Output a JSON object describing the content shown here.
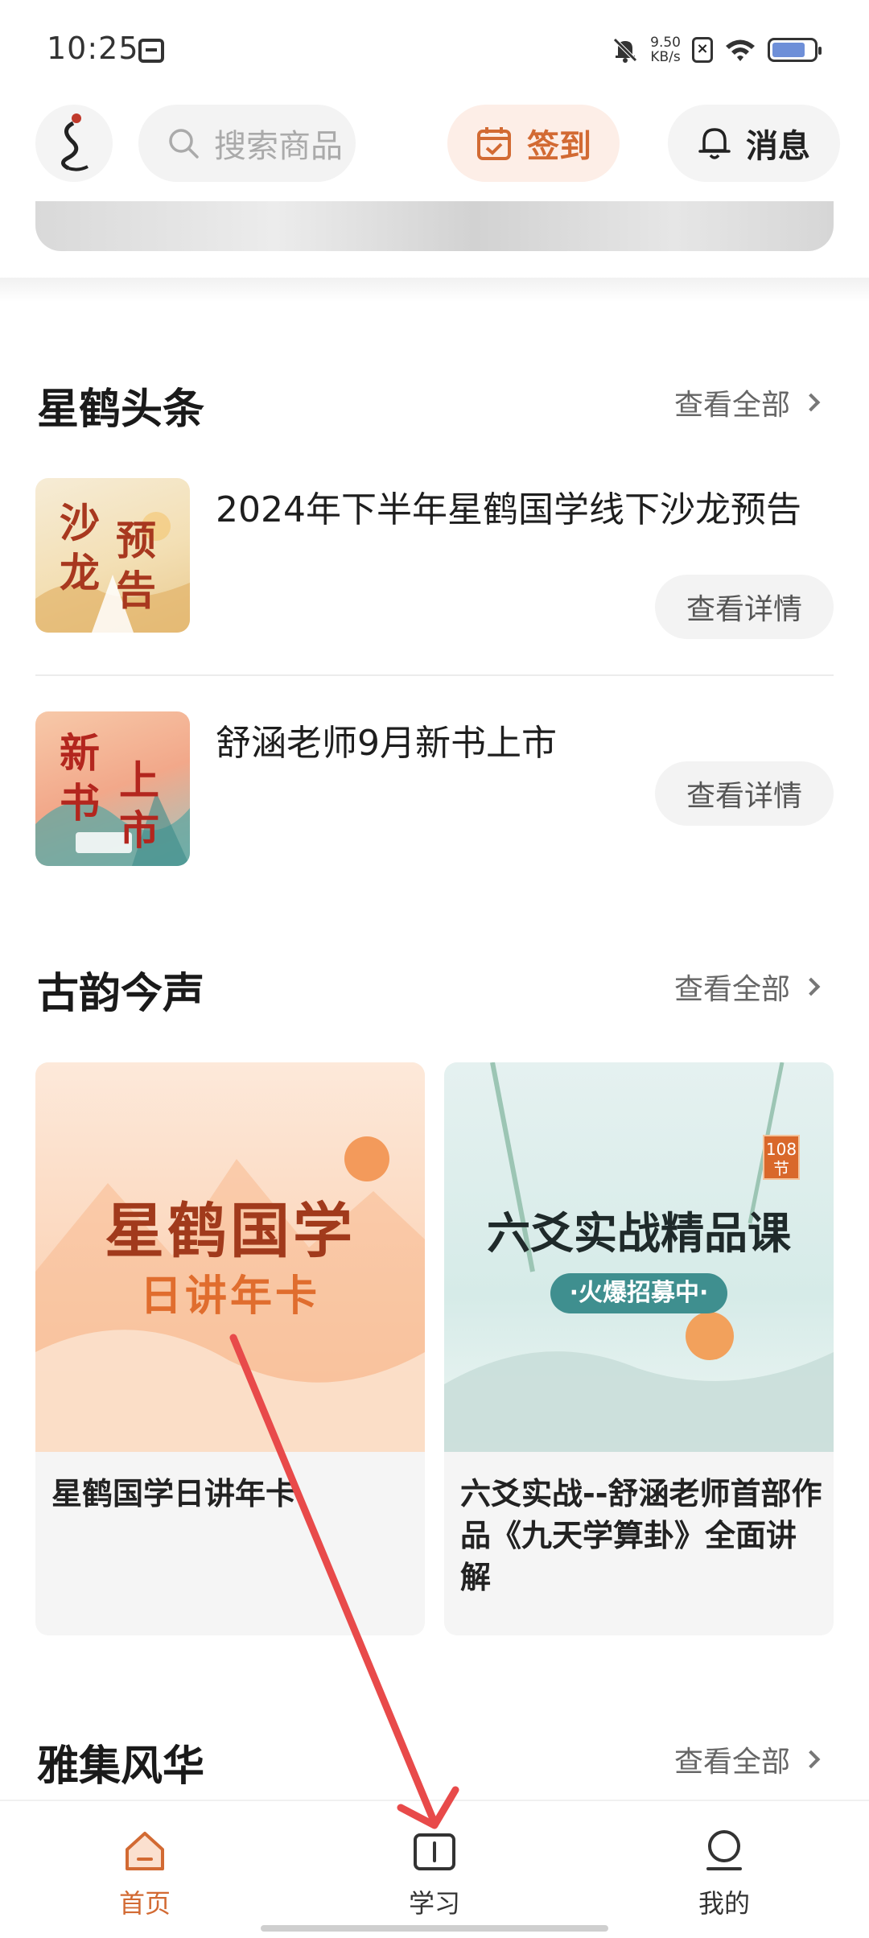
{
  "status_bar": {
    "time": "10:25",
    "net_speed_value": "9.50",
    "net_speed_unit": "KB/s",
    "battery_percent": 80
  },
  "header": {
    "search_placeholder": "搜索商品",
    "checkin_label": "签到",
    "message_label": "消息"
  },
  "colors": {
    "accent": "#d26a33",
    "checkin_bg": "#fdeee7",
    "arrow": "#e84a4a"
  },
  "headlines": {
    "title": "星鹤头条",
    "see_all": "查看全部",
    "items": [
      {
        "title": "2024年下半年星鹤国学线下沙龙预告",
        "button": "查看详情",
        "thumb_text": [
          "沙",
          "预",
          "龙",
          "告"
        ]
      },
      {
        "title": "舒涵老师9月新书上市",
        "button": "查看详情",
        "thumb_text": [
          "新",
          "上",
          "书",
          "市"
        ]
      }
    ]
  },
  "courses": {
    "title": "古韵今声",
    "see_all": "查看全部",
    "cards": [
      {
        "image_title": "星鹤国学",
        "image_subtitle": "日讲年卡",
        "title": "星鹤国学日讲年卡"
      },
      {
        "image_title": "六爻实战精品课",
        "image_subtitle": "·火爆招募中·",
        "image_badge_top": "108",
        "image_badge_bottom": "节",
        "title": "六爻实战--舒涵老师首部作品《九天学算卦》全面讲解"
      }
    ]
  },
  "gallery": {
    "title": "雅集风华",
    "see_all": "查看全部"
  },
  "tabbar": {
    "home": "首页",
    "study": "学习",
    "mine": "我的"
  }
}
